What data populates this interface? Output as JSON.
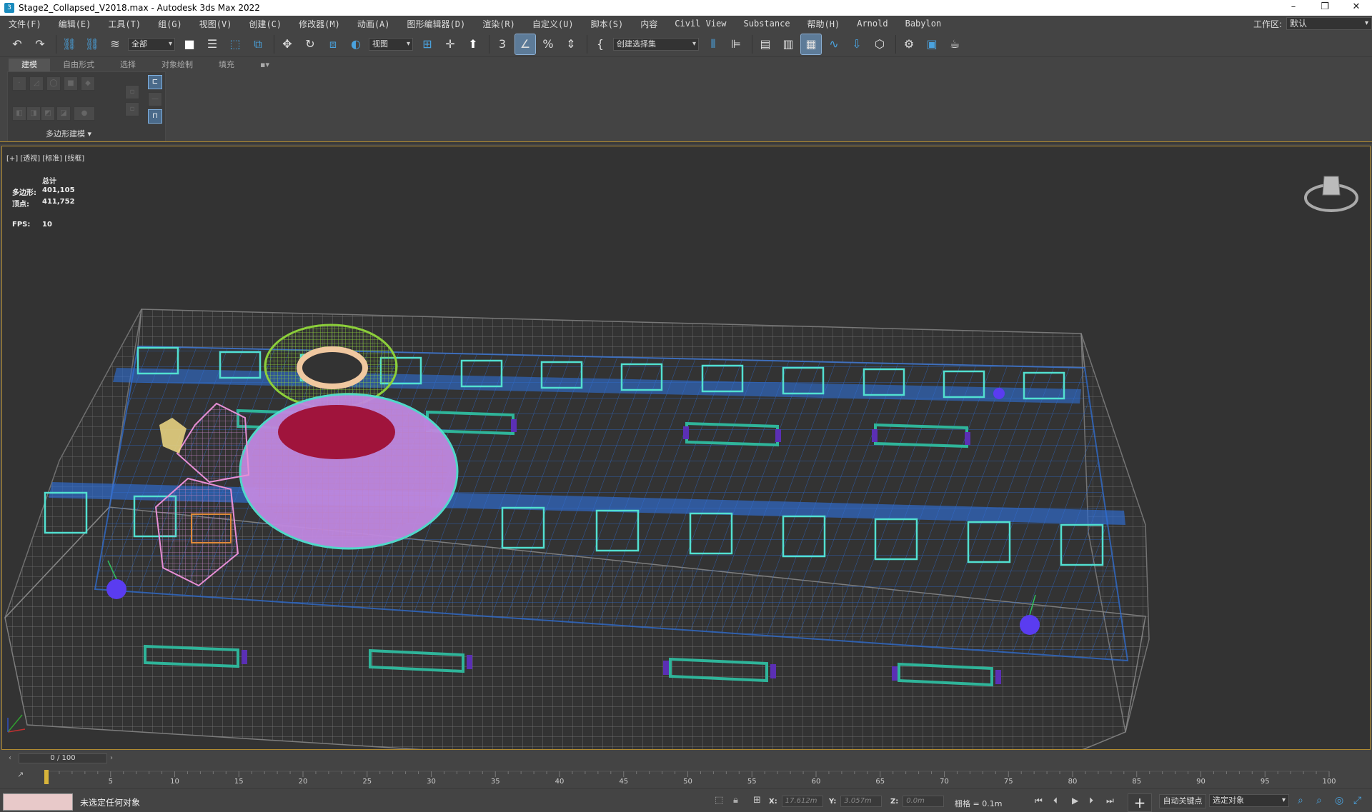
{
  "window": {
    "title": "Stage2_Collapsed_V2018.max - Autodesk 3ds Max 2022",
    "app_icon_text": "3",
    "minimize": "–",
    "restore": "❐",
    "close": "✕"
  },
  "menu": {
    "items": [
      "文件(F)",
      "编辑(E)",
      "工具(T)",
      "组(G)",
      "视图(V)",
      "创建(C)",
      "修改器(M)",
      "动画(A)",
      "图形编辑器(D)",
      "渲染(R)",
      "自定义(U)",
      "脚本(S)",
      "内容",
      "Civil View",
      "Substance",
      "帮助(H)",
      "Arnold",
      "Babylon"
    ],
    "workspace_label": "工作区:",
    "workspace_value": "默认"
  },
  "toolbar": {
    "filter_value": "全部",
    "refcoord_value": "视图",
    "selection_set_placeholder": "创建选择集"
  },
  "ribbon": {
    "tabs": [
      "建模",
      "自由形式",
      "选择",
      "对象绘制",
      "填充"
    ],
    "active_tab": "建模",
    "panel_label": "多边形建模 ▾"
  },
  "viewport": {
    "label": "[+] [透视] [标准] [线框]",
    "stats_header": "总计",
    "stats": [
      {
        "key": "多边形:",
        "value": "401,105"
      },
      {
        "key": "顶点:",
        "value": "411,752"
      }
    ],
    "fps_key": "FPS:",
    "fps_value": "10"
  },
  "timeline": {
    "frame_display": "0 / 100",
    "ticks": [
      "5",
      "10",
      "15",
      "20",
      "25",
      "30",
      "35",
      "40",
      "45",
      "50",
      "55",
      "60",
      "65",
      "70",
      "75",
      "80",
      "85",
      "90",
      "95",
      "100"
    ]
  },
  "status": {
    "message": "未选定任何对象",
    "x_label": "X:",
    "x_value": "17.612m",
    "y_label": "Y:",
    "y_value": "3.057m",
    "z_label": "Z:",
    "z_value": "0.0m",
    "grid": "栅格 = 0.1m",
    "autokey": "自动关键点",
    "selected_mode": "选定对象"
  },
  "colors": {
    "accent_border": "#b08a32",
    "wire_blue": "#2f6fd6",
    "wire_gray": "#8a8a8a",
    "wire_teal": "#2fb59a",
    "wire_green": "#8ccf3a",
    "wire_pink": "#e88fd6",
    "wire_red": "#a0143c"
  }
}
